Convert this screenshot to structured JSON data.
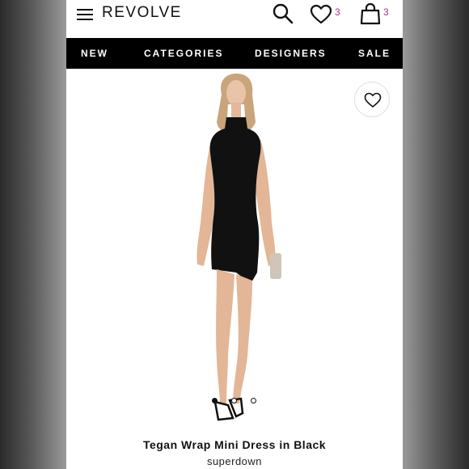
{
  "header": {
    "logo": "REVOLVE",
    "wishlist_count": "3",
    "bag_count": "3"
  },
  "nav": {
    "items": [
      "NEW",
      "CATEGORIES",
      "DESIGNERS",
      "SALE"
    ]
  },
  "product": {
    "title": "Tegan Wrap Mini Dress in Black",
    "brand": "superdown",
    "image_count": 3,
    "active_image": 1
  },
  "colors": {
    "accent": "#b0358a",
    "nav_bg": "#000000",
    "dress": "#111111"
  },
  "icons": [
    "menu-icon",
    "search-icon",
    "heart-icon",
    "bag-icon",
    "favorite-heart-icon"
  ]
}
